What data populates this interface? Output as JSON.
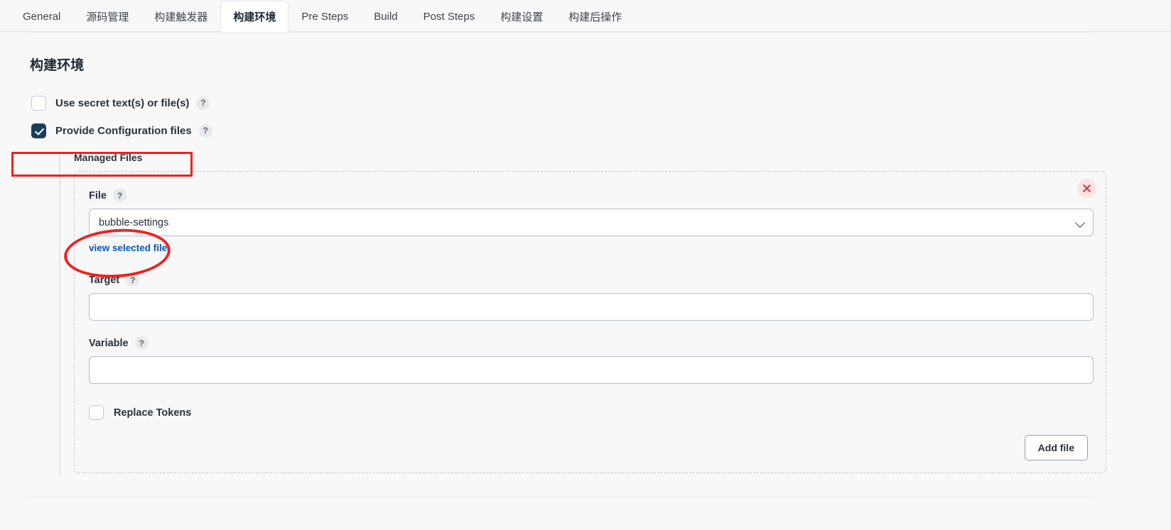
{
  "tabs": [
    {
      "label": "General",
      "active": false
    },
    {
      "label": "源码管理",
      "active": false
    },
    {
      "label": "构建触发器",
      "active": false
    },
    {
      "label": "构建环境",
      "active": true
    },
    {
      "label": "Pre Steps",
      "active": false
    },
    {
      "label": "Build",
      "active": false
    },
    {
      "label": "Post Steps",
      "active": false
    },
    {
      "label": "构建设置",
      "active": false
    },
    {
      "label": "构建后操作",
      "active": false
    }
  ],
  "section": {
    "title": "构建环境"
  },
  "options": {
    "secret_text": {
      "label": "Use secret text(s) or file(s)",
      "checked": false,
      "help": "?"
    },
    "config_files": {
      "label": "Provide Configuration files",
      "checked": true,
      "help": "?"
    }
  },
  "managed_files": {
    "label": "Managed Files",
    "entry": {
      "file": {
        "label": "File",
        "help": "?",
        "value": "bubble-settings",
        "view_link": "view selected file",
        "chevron": "chevron-down-icon"
      },
      "target": {
        "label": "Target",
        "help": "?",
        "value": "",
        "placeholder": ""
      },
      "variable": {
        "label": "Variable",
        "help": "?",
        "value": "",
        "placeholder": ""
      },
      "replace_tokens": {
        "label": "Replace Tokens",
        "checked": false
      },
      "delete_icon": "close-icon"
    },
    "add_file_label": "Add file"
  },
  "annotations": {
    "checkbox_highlight": {
      "color": "#ee2222"
    },
    "select_highlight": {
      "color": "#ee2222"
    }
  }
}
